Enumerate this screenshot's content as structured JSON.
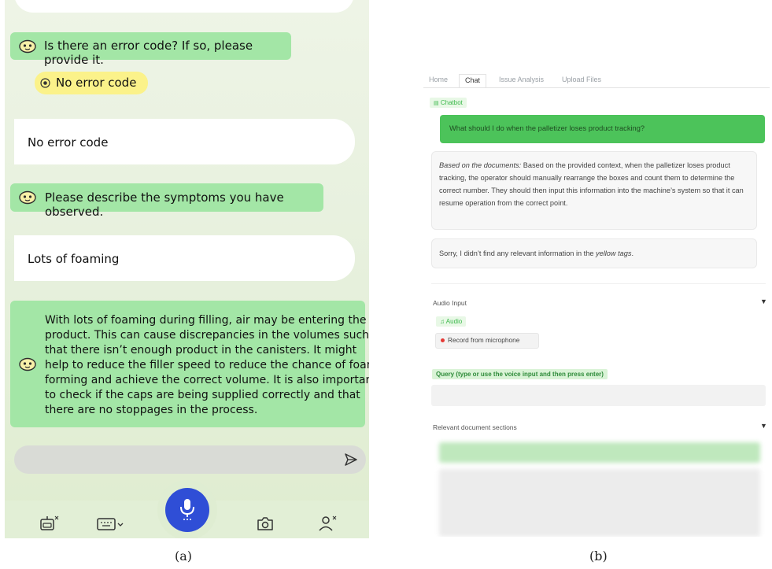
{
  "panel_a": {
    "q_error": "Is there an error code? If so, please provide it.",
    "chip_no_error": "No error code",
    "user_no_error": "No error code",
    "q_symptoms": "Please describe the symptoms you have observed.",
    "user_foaming": "Lots of foaming",
    "answer_lines": [
      "With lots of foaming during filling, air may be entering the",
      "product. This can cause discrepancies in the volumes such",
      "that there isn’t enough product in the canisters. It might",
      "help to reduce the filler speed to reduce the chance of foam",
      "forming and achieve the correct volume. It is also important",
      "to check if the caps are being supplied correctly and that",
      "there are no stoppages in the process."
    ],
    "caption": "(a)"
  },
  "panel_b": {
    "tabs": [
      "Home",
      "Chat",
      "Issue Analysis",
      "Upload Files"
    ],
    "active_tab": "Chat",
    "chatbot_label": "Chatbot",
    "user_question": "What should I do when the palletizer loses product tracking?",
    "answer_prefix": "Based on the documents:",
    "answer_text": " Based on the provided context, when the palletizer loses product tracking, the operator should manually rearrange the boxes and count them to determine the correct number. They should then input this information into the machine’s system so that it can resume operation from the correct point.",
    "sorry_prefix": "Sorry, I didn’t find any relevant information in the ",
    "sorry_em": "yellow tags",
    "sorry_suffix": ".",
    "audio_input_title": "Audio Input",
    "audio_label": "Audio",
    "record_label": "Record from microphone",
    "query_label": "Query (type or use the voice input and then press enter)",
    "relevant_title": "Relevant document sections",
    "caption": "(b)"
  },
  "colors": {
    "bot_bubble": "#a3e6a6",
    "chip_yellow": "#fbf28a",
    "mic_blue": "#2f4ed6",
    "accent_green": "#4cc35a"
  }
}
